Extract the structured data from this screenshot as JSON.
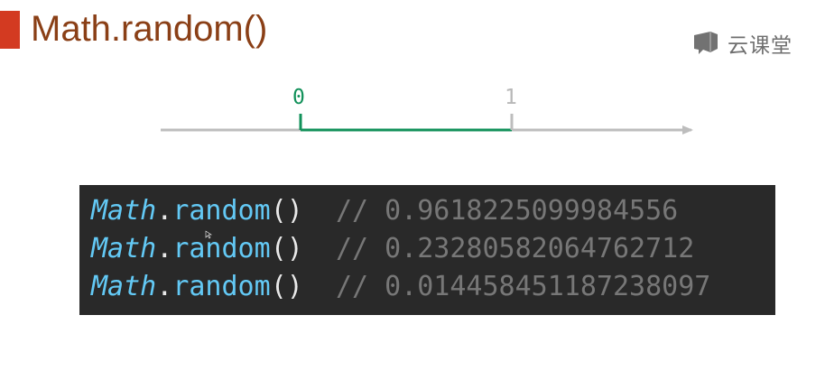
{
  "header": {
    "title": "Math.random()",
    "brand_name": "云课堂",
    "brand_icon": "cloud-classroom-logo-icon"
  },
  "number_line": {
    "start_label": "0",
    "end_label": "1",
    "active_color": "#12915a",
    "axis_color": "#bdbdbd"
  },
  "code": {
    "lines": [
      {
        "object": "Math",
        "dot": ".",
        "method": "random",
        "parens": "()",
        "comment": "// 0.9618225099984556"
      },
      {
        "object": "Math",
        "dot": ".",
        "method": "random",
        "parens": "()",
        "comment": "// 0.23280582064762712"
      },
      {
        "object": "Math",
        "dot": ".",
        "method": "random",
        "parens": "()",
        "comment": "// 0.014458451187238097"
      }
    ],
    "background": "#292929",
    "token_color": "#63c9f5",
    "comment_color": "#777777"
  }
}
